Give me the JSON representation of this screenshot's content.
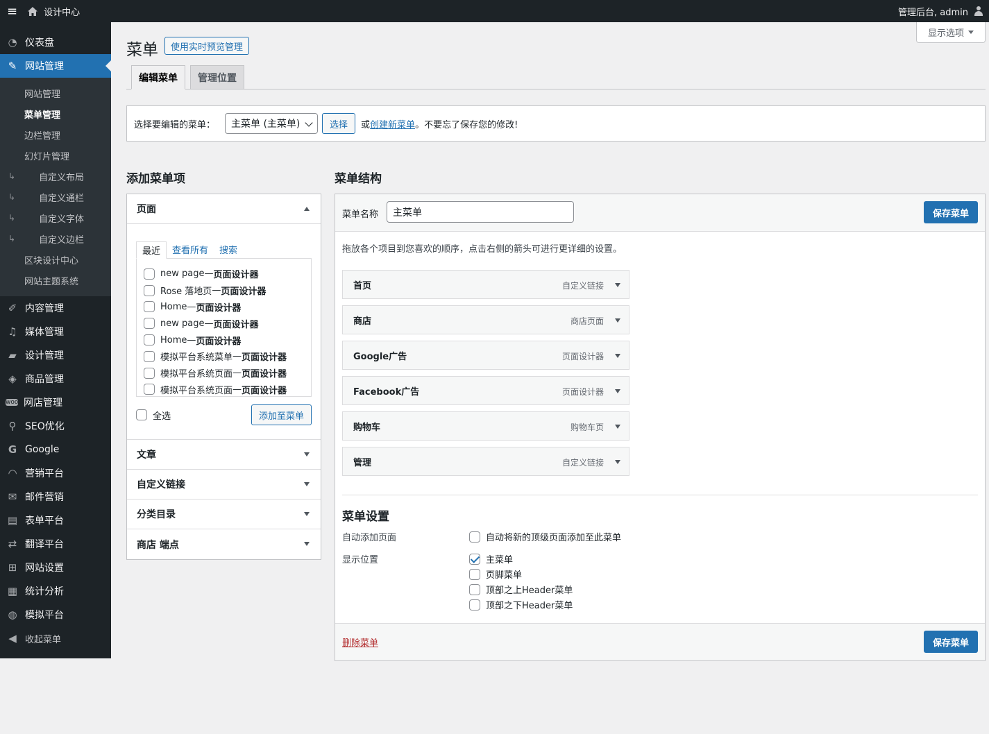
{
  "adminbar": {
    "site_name": "设计中心",
    "greeting": "管理后台, admin"
  },
  "sidebar": {
    "items": [
      {
        "label": "仪表盘",
        "icon": "dashboard-icon"
      },
      {
        "label": "网站管理",
        "icon": "pin-icon",
        "current": true
      },
      {
        "label": "内容管理",
        "icon": "pencil-icon"
      },
      {
        "label": "媒体管理",
        "icon": "media-icon"
      },
      {
        "label": "设计管理",
        "icon": "folder-icon"
      },
      {
        "label": "商品管理",
        "icon": "box-icon"
      },
      {
        "label": "网店管理",
        "icon": "woo-icon"
      },
      {
        "label": "SEO优化",
        "icon": "search-icon"
      },
      {
        "label": "Google",
        "icon": "google-icon"
      },
      {
        "label": "营销平台",
        "icon": "rss-icon"
      },
      {
        "label": "邮件营销",
        "icon": "mail-icon"
      },
      {
        "label": "表单平台",
        "icon": "form-icon"
      },
      {
        "label": "翻译平台",
        "icon": "translate-icon"
      },
      {
        "label": "网站设置",
        "icon": "settings-icon"
      },
      {
        "label": "统计分析",
        "icon": "chart-icon"
      },
      {
        "label": "模拟平台",
        "icon": "globe-icon"
      }
    ],
    "submenu": [
      {
        "label": "网站管理"
      },
      {
        "label": "菜单管理",
        "current": true
      },
      {
        "label": "边栏管理"
      },
      {
        "label": "幻灯片管理"
      },
      {
        "label": "自定义布局",
        "child": true
      },
      {
        "label": "自定义通栏",
        "child": true
      },
      {
        "label": "自定义字体",
        "child": true
      },
      {
        "label": "自定义边栏",
        "child": true
      },
      {
        "label": "区块设计中心"
      },
      {
        "label": "网站主题系统"
      }
    ],
    "collapse_label": "收起菜单"
  },
  "screen_options": "显示选项",
  "page": {
    "title": "菜单",
    "live_preview": "使用实时预览管理"
  },
  "tabs": {
    "edit": "编辑菜单",
    "locations": "管理位置"
  },
  "manage": {
    "label": "选择要编辑的菜单：",
    "selected": "主菜单 (主菜单)",
    "select_btn": "选择",
    "or": "或",
    "create_link": "创建新菜单",
    "reminder": "。不要忘了保存您的修改!"
  },
  "add_items": {
    "title": "添加菜单项",
    "pages_title": "页面",
    "tab_recent": "最近",
    "tab_all": "查看所有",
    "tab_search": "搜索",
    "pages": [
      {
        "name": "new page",
        "sep": " — ",
        "suffix": "页面设计器"
      },
      {
        "name": "Rose 落地页",
        "sep": " — ",
        "suffix": "页面设计器"
      },
      {
        "name": "Home",
        "sep": " — ",
        "suffix": "页面设计器"
      },
      {
        "name": "new page",
        "sep": " — ",
        "suffix": "页面设计器"
      },
      {
        "name": "Home",
        "sep": " — ",
        "suffix": "页面设计器"
      },
      {
        "name": "模拟平台系统菜单",
        "sep": " — ",
        "suffix": "页面设计器"
      },
      {
        "name": "模拟平台系统页面",
        "sep": " — ",
        "suffix": "页面设计器"
      },
      {
        "name": "模拟平台系统页面",
        "sep": " — ",
        "suffix": "页面设计器"
      }
    ],
    "select_all": "全选",
    "add_btn": "添加至菜单",
    "sections": [
      "文章",
      "自定义链接",
      "分类目录",
      "商店 端点"
    ]
  },
  "structure": {
    "title": "菜单结构",
    "name_label": "菜单名称",
    "name_value": "主菜单",
    "save_btn": "保存菜单",
    "instructions": "拖放各个项目到您喜欢的顺序，点击右侧的箭头可进行更详细的设置。",
    "items": [
      {
        "title": "首页",
        "type": "自定义链接"
      },
      {
        "title": "商店",
        "type": "商店页面"
      },
      {
        "title": "Google广告",
        "type": "页面设计器"
      },
      {
        "title": "Facebook广告",
        "type": "页面设计器"
      },
      {
        "title": "购物车",
        "type": "购物车页"
      },
      {
        "title": "管理",
        "type": "自定义链接"
      }
    ]
  },
  "settings": {
    "title": "菜单设置",
    "auto_add_label": "自动添加页面",
    "auto_add_option": "自动将新的顶级页面添加至此菜单",
    "location_label": "显示位置",
    "locations": [
      {
        "label": "主菜单",
        "checked": true
      },
      {
        "label": "页脚菜单",
        "checked": false
      },
      {
        "label": "顶部之上Header菜单",
        "checked": false
      },
      {
        "label": "顶部之下Header菜单",
        "checked": false
      }
    ],
    "delete_link": "删除菜单"
  }
}
